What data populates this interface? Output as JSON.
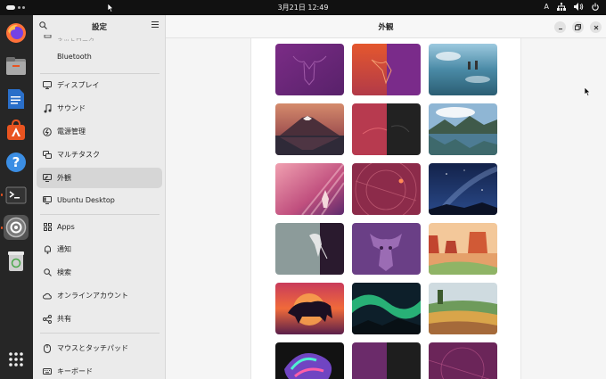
{
  "topbar": {
    "clock": "3月21日  12:49",
    "input_method": "A"
  },
  "sidebar": {
    "title": "設定",
    "items": [
      {
        "label": "Bluetooth",
        "icon": "bluetooth-icon"
      },
      {
        "label": "ディスプレイ",
        "icon": "display-icon"
      },
      {
        "label": "サウンド",
        "icon": "music-note-icon"
      },
      {
        "label": "電源管理",
        "icon": "power-icon"
      },
      {
        "label": "マルチタスク",
        "icon": "multitasking-icon"
      },
      {
        "label": "外観",
        "icon": "appearance-icon",
        "active": true
      },
      {
        "label": "Ubuntu Desktop",
        "icon": "ubuntu-desktop-icon"
      },
      {
        "label": "Apps",
        "icon": "apps-grid-icon"
      },
      {
        "label": "通知",
        "icon": "bell-icon"
      },
      {
        "label": "検索",
        "icon": "search-icon"
      },
      {
        "label": "オンラインアカウント",
        "icon": "cloud-icon"
      },
      {
        "label": "共有",
        "icon": "share-icon"
      },
      {
        "label": "マウスとタッチパッド",
        "icon": "mouse-icon"
      },
      {
        "label": "キーボード",
        "icon": "keyboard-icon"
      }
    ]
  },
  "main": {
    "title": "外観",
    "wallpapers": [
      "numbat-purple",
      "numbat-orange-split",
      "lake-reflection",
      "mount-fuji",
      "red-dark-split",
      "alpine-lake",
      "pink-rays",
      "purple-circles",
      "milky-way",
      "numbat-gray-split",
      "purple-dragon",
      "red-canyon",
      "bull-sunset",
      "aurora",
      "painted-fields",
      "colorful-jelly",
      "purple-dark-split",
      "purple-circles-2"
    ]
  },
  "dock": [
    "firefox",
    "files",
    "writer",
    "app-center",
    "help",
    "terminal",
    "settings",
    "trash",
    "show-apps"
  ]
}
